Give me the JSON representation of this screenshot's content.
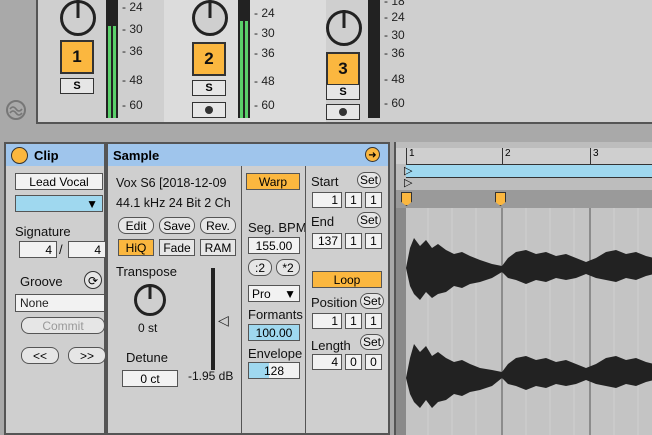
{
  "mixer": {
    "tracks": [
      {
        "number": "1",
        "solo": "S",
        "meter_level": 0.78
      },
      {
        "number": "2",
        "solo": "S",
        "meter_level": 0.82
      },
      {
        "number": "3",
        "solo": "S",
        "meter_level": 0.0
      }
    ],
    "scale_ticks": [
      "24",
      "30",
      "36",
      "48",
      "60"
    ],
    "scale_ticks_3": [
      "18",
      "24",
      "30",
      "36",
      "48",
      "60"
    ]
  },
  "clip": {
    "title": "Clip",
    "name": "Lead Vocal",
    "signature_label": "Signature",
    "sig_num": "4",
    "sig_sep": "/",
    "sig_den": "4",
    "groove_label": "Groove",
    "groove_value": "None",
    "commit": "Commit",
    "prev": "<<",
    "next": ">>"
  },
  "sample": {
    "title": "Sample",
    "file": "Vox S6 [2018-12-09",
    "info": "44.1 kHz 24 Bit 2 Ch",
    "edit": "Edit",
    "save": "Save",
    "rev": "Rev.",
    "hiq": "HiQ",
    "fade": "Fade",
    "ram": "RAM",
    "transpose_label": "Transpose",
    "transpose_value": "0 st",
    "detune_label": "Detune",
    "detune_value": "0 ct",
    "gain_value": "-1.95 dB",
    "warp": "Warp",
    "seg_bpm_label": "Seg. BPM",
    "seg_bpm": "155.00",
    "half": ":2",
    "double": "*2",
    "warp_mode": "Pro",
    "formants_label": "Formants",
    "formants": "100.00",
    "envelope_label": "Envelope",
    "envelope": "128",
    "start_label": "Start",
    "start": [
      "1",
      "1",
      "1"
    ],
    "set": "Set",
    "end_label": "End",
    "end": [
      "137",
      "1",
      "1"
    ],
    "loop": "Loop",
    "position_label": "Position",
    "position": [
      "1",
      "1",
      "1"
    ],
    "length_label": "Length",
    "length": [
      "4",
      "0",
      "0"
    ]
  },
  "editor": {
    "ruler": [
      "1",
      "2",
      "3"
    ]
  }
}
